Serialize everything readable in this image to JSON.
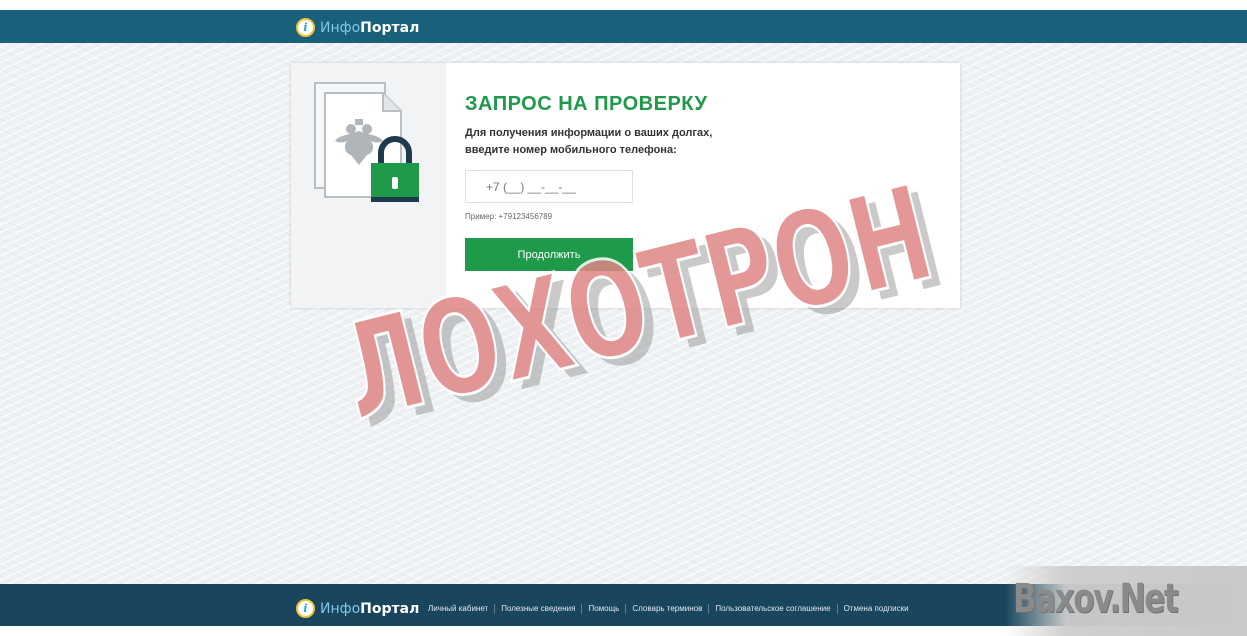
{
  "header": {
    "logo_part1": "Инфо",
    "logo_part2": "Портал",
    "logo_icon": "info-icon"
  },
  "card": {
    "title": "ЗАПРОС НА ПРОВЕРКУ",
    "description": "Для получения информации о ваших долгах, введите номер мобильного телефона:",
    "phone_placeholder": "+7 (__) __-__-__",
    "example": "Пример: +79123456789",
    "continue_label": "Продолжить",
    "illustration": "document-with-coat-of-arms-and-padlock"
  },
  "stamp": {
    "text": "ЛОХОТРОН",
    "color": "#e07a7a"
  },
  "footer": {
    "logo_part1": "Инфо",
    "logo_part2": "Портал",
    "links": [
      "Личный кабинет",
      "Полезные сведения",
      "Помощь",
      "Словарь терминов",
      "Пользовательское соглашение",
      "Отмена подписки"
    ]
  },
  "watermark": {
    "text": "Baxov.Net"
  },
  "colors": {
    "header_bg": "#19607a",
    "footer_bg": "#19465d",
    "accent_green": "#1f9a4a"
  }
}
